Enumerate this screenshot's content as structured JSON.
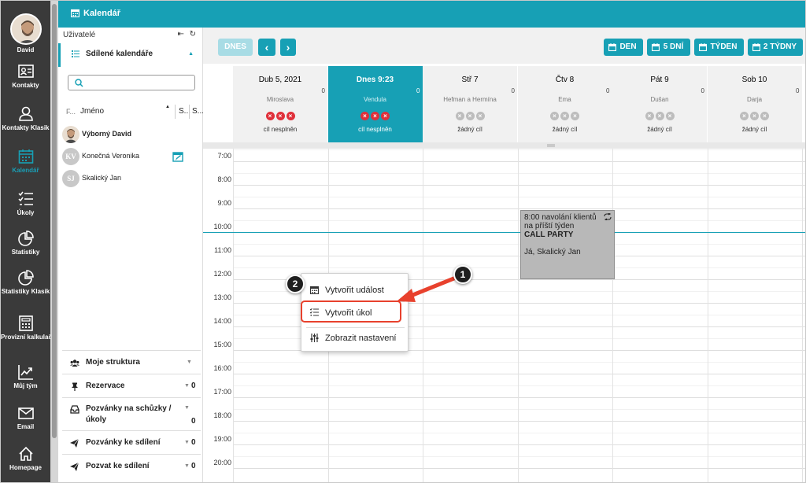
{
  "nav": {
    "user": "David",
    "items": [
      {
        "label": "Kontakty",
        "icon": "contacts-icon"
      },
      {
        "label": "Kontakty Klasik",
        "icon": "user-icon"
      },
      {
        "label": "Kalendář",
        "icon": "calendar-icon"
      },
      {
        "label": "Úkoly",
        "icon": "task-list-icon"
      },
      {
        "label": "Statistiky",
        "icon": "pie-chart-icon"
      },
      {
        "label": "Statistiky Klasik",
        "icon": "pie-chart-icon"
      },
      {
        "label": "Provizní kalkulačka",
        "icon": "calculator-icon"
      },
      {
        "label": "Můj tým",
        "icon": "trend-chart-icon"
      },
      {
        "label": "Email",
        "icon": "envelope-icon"
      },
      {
        "label": "Homepage",
        "icon": "home-icon"
      }
    ],
    "active_index": 2
  },
  "topbar": {
    "title": "Kalendář"
  },
  "panel": {
    "users_label": "Uživatelé",
    "header_icons": "⇤ ↻",
    "shared_label": "Sdílené kalendáře",
    "columns": {
      "f": "F...",
      "name": "Jméno",
      "s1": "S...",
      "s2": "S..."
    },
    "users": [
      {
        "name": "Výborný David",
        "initials": "",
        "bold": true
      },
      {
        "name": "Konečná Veronika",
        "initials": "KV",
        "bold": false
      },
      {
        "name": "Skalický Jan",
        "initials": "SJ",
        "bold": false
      }
    ],
    "sections": [
      {
        "label": "Moje struktura",
        "count": ""
      },
      {
        "label": "Rezervace",
        "count": "0"
      },
      {
        "label": "Pozvánky na schůzky / úkoly",
        "count": "0"
      },
      {
        "label": "Pozvánky ke sdílení",
        "count": "0"
      },
      {
        "label": "Pozvat ke sdílení",
        "count": "0"
      }
    ]
  },
  "toolbar": {
    "today": "DNES",
    "prev": "‹",
    "next": "›",
    "views": [
      "DEN",
      "5 DNÍ",
      "TÝDEN",
      "2 TÝDNY"
    ]
  },
  "days": [
    {
      "date": "Dub 5, 2021",
      "user": "Miroslava",
      "zero": "0",
      "goal": "cíl nesplněn",
      "status": "red",
      "today": false
    },
    {
      "date": "Dnes 9:23",
      "user": "Vendula",
      "zero": "0",
      "goal": "cíl nesplněn",
      "status": "red",
      "today": true
    },
    {
      "date": "Stř 7",
      "user": "Hefman a Hermína",
      "zero": "0",
      "goal": "žádný cíl",
      "status": "grey",
      "today": false
    },
    {
      "date": "Čtv 8",
      "user": "Ema",
      "zero": "0",
      "goal": "žádný cíl",
      "status": "grey",
      "today": false
    },
    {
      "date": "Pát 9",
      "user": "Dušan",
      "zero": "0",
      "goal": "žádný cíl",
      "status": "grey",
      "today": false
    },
    {
      "date": "Sob 10",
      "user": "Darja",
      "zero": "0",
      "goal": "žádný cíl",
      "status": "grey",
      "today": false
    }
  ],
  "x_mark": "×",
  "hours": [
    "7:00",
    "8:00",
    "9:00",
    "10:00",
    "11:00",
    "12:00",
    "13:00",
    "14:00",
    "15:00",
    "16:00",
    "17:00",
    "18:00",
    "19:00",
    "20:00"
  ],
  "event": {
    "line1": "8:00 navolání klientů",
    "line2": "na příští týden",
    "title": "CALL PARTY",
    "people": "Já, Skalický Jan"
  },
  "context_menu": {
    "create_event": "Vytvořit událost",
    "create_task": "Vytvořit úkol",
    "show_settings": "Zobrazit nastavení"
  },
  "badges": {
    "one": "1",
    "two": "2"
  },
  "colors": {
    "accent": "#17a0b5",
    "nav_bg": "#3a3a3a",
    "highlight": "#e8412d"
  }
}
